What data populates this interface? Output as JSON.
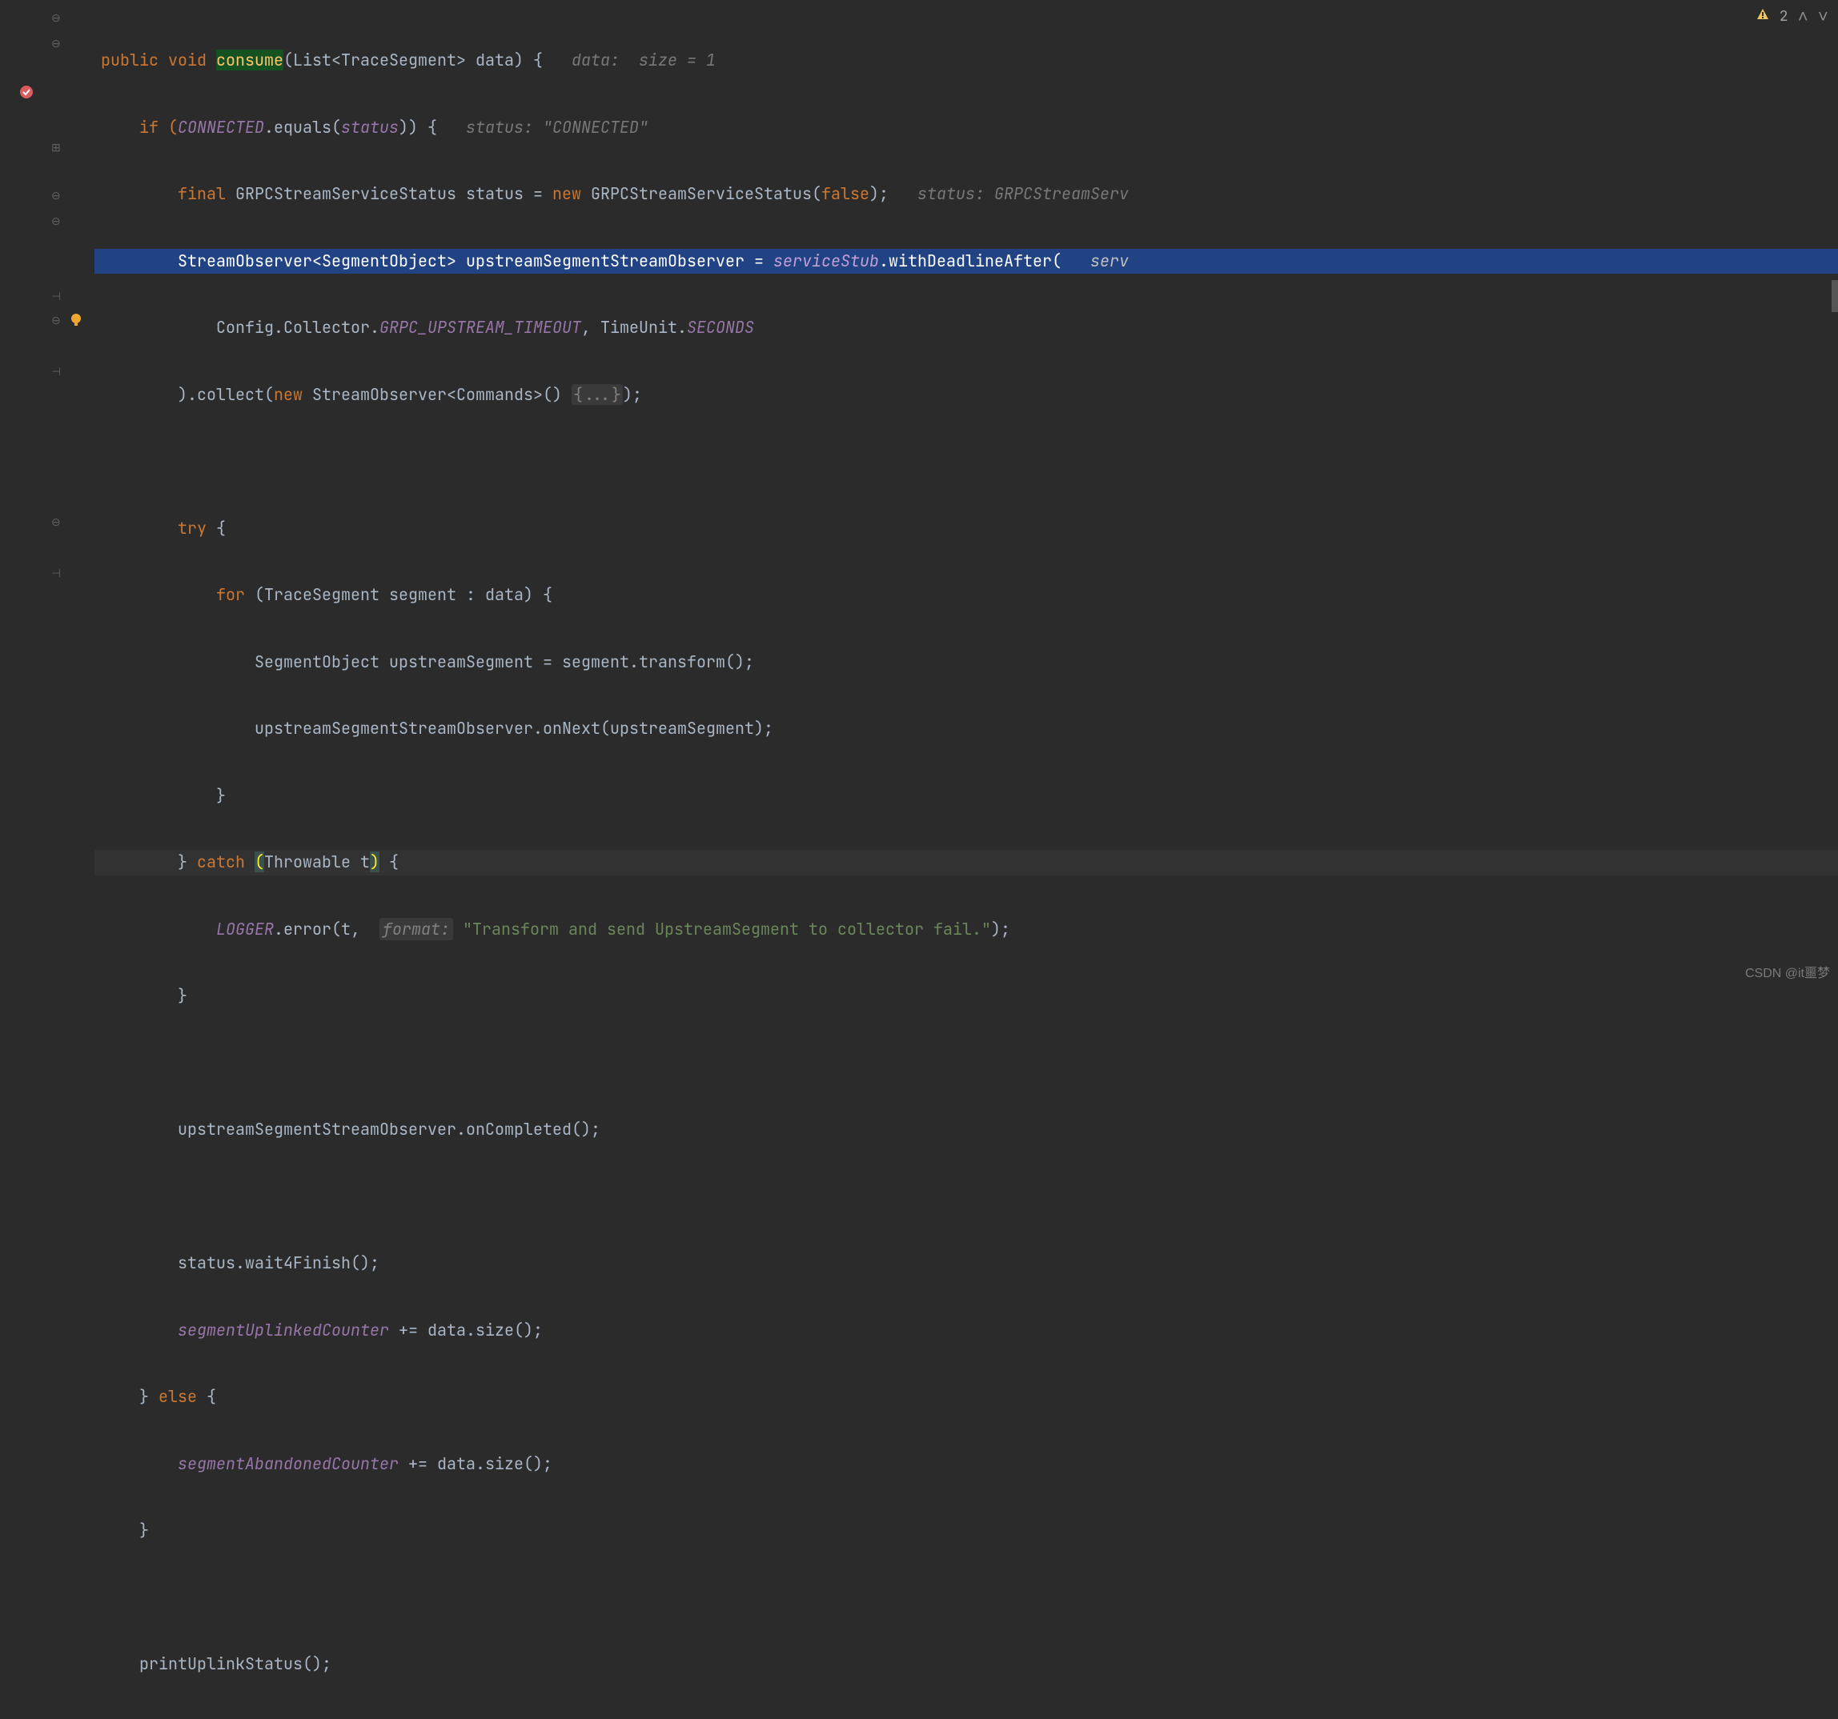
{
  "top_right": {
    "warn_count": "2"
  },
  "watermark": "CSDN @it噩梦",
  "gutter": {
    "breakpoint_line": 4,
    "bulb_line": 13
  },
  "code": {
    "l1": {
      "a": "public void ",
      "b": "consume",
      "c": "(List<TraceSegment> data) {",
      "h": "data:  size = 1"
    },
    "l2": {
      "a": "if (",
      "b": "CONNECTED",
      "c": ".equals(",
      "d": "status",
      "e": ")) {",
      "h": "status: \"CONNECTED\""
    },
    "l3": {
      "a": "final ",
      "b": "GRPCStreamServiceStatus status = ",
      "c": "new ",
      "d": "GRPCStreamServiceStatus(",
      "e": "false",
      "f": ");",
      "h": "status: GRPCStreamServ"
    },
    "l4": {
      "a": "StreamObserver<SegmentObject> upstreamSegmentStreamObserver = ",
      "b": "serviceStub",
      "c": ".withDeadlineAfter(",
      "h": "serv"
    },
    "l5": {
      "a": "Config.Collector.",
      "b": "GRPC_UPSTREAM_TIMEOUT",
      "c": ", TimeUnit.",
      "d": "SECONDS"
    },
    "l6": {
      "a": ").collect(",
      "b": "new ",
      "c": "StreamObserver<Commands>() ",
      "d": "{...}",
      "e": ");"
    },
    "l7": "",
    "l8": {
      "a": "try ",
      "b": "{"
    },
    "l9": {
      "a": "for ",
      "b": "(TraceSegment segment : data) {"
    },
    "l10": "SegmentObject upstreamSegment = segment.transform();",
    "l11": "upstreamSegmentStreamObserver.onNext(upstreamSegment);",
    "l12": "}",
    "l13": {
      "a": "} ",
      "b": "catch ",
      "c": "(",
      "d": "Throwable t",
      "e": ")",
      "f": " {"
    },
    "l14": {
      "a": "LOGGER",
      "b": ".error(t, ",
      "h": "format:",
      "c": " \"Transform and send UpstreamSegment to collector fail.\"",
      "d": ");"
    },
    "l15": "}",
    "l16": "",
    "l17": "upstreamSegmentStreamObserver.onCompleted();",
    "l18": "",
    "l19": "status.wait4Finish();",
    "l20": {
      "a": "segmentUplinkedCounter",
      "b": " += data.size();"
    },
    "l21": {
      "a": "} ",
      "b": "else ",
      "c": "{"
    },
    "l22": {
      "a": "segmentAbandonedCounter",
      "b": " += data.size();"
    },
    "l23": "}",
    "l24": "",
    "l25": "printUplinkStatus();"
  }
}
